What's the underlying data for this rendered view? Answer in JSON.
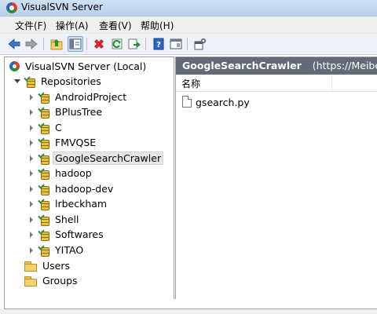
{
  "window": {
    "title": "VisualSVN Server"
  },
  "menu": [
    "文件(F)",
    "操作(A)",
    "查看(V)",
    "帮助(H)"
  ],
  "toolbar": {
    "icons": [
      "back-arrow-icon",
      "forward-arrow-icon",
      "up-folder-icon",
      "show-tree-icon",
      "delete-icon",
      "refresh-icon",
      "export-icon",
      "help-icon",
      "properties-icon",
      "settings-icon"
    ]
  },
  "tree": {
    "root": "VisualSVN Server (Local)",
    "repositories_label": "Repositories",
    "repositories": [
      "AndroidProject",
      "BPlusTree",
      "C",
      "FMVQSE",
      "GoogleSearchCrawler",
      "hadoop",
      "hadoop-dev",
      "lrbeckham",
      "Shell",
      "Softwares",
      "YITAO"
    ],
    "selected": "GoogleSearchCrawler",
    "users_label": "Users",
    "groups_label": "Groups"
  },
  "details": {
    "header_name": "GoogleSearchCrawler",
    "header_url": "(https://Meibenjin",
    "column_name": "名称",
    "files": [
      "gsearch.py"
    ]
  }
}
